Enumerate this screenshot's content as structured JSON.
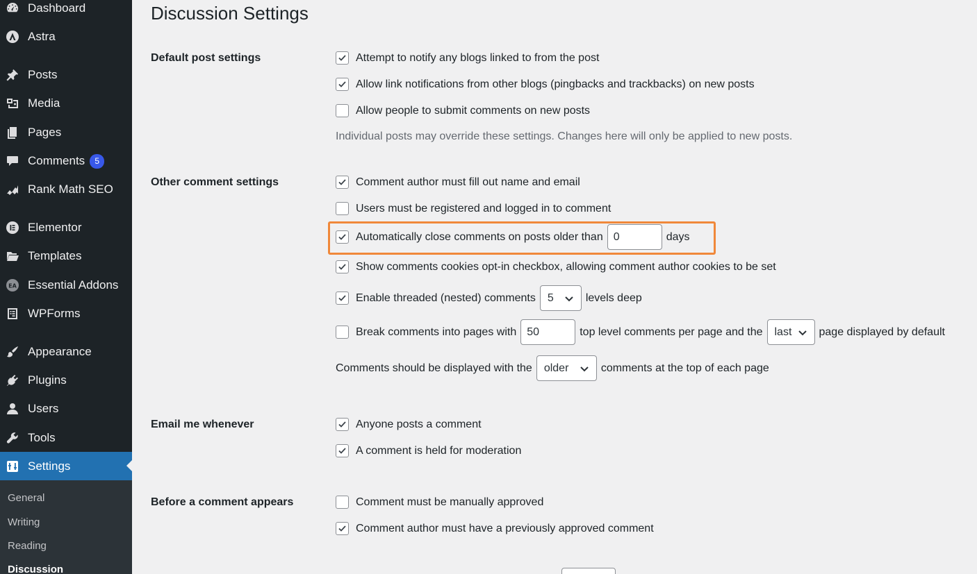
{
  "sidebar": {
    "items": [
      {
        "label": "Dashboard",
        "icon": "dashboard-icon"
      },
      {
        "label": "Astra",
        "icon": "astra-icon"
      },
      {
        "label": "Posts",
        "icon": "pin-icon"
      },
      {
        "label": "Media",
        "icon": "media-icon"
      },
      {
        "label": "Pages",
        "icon": "pages-icon"
      },
      {
        "label": "Comments",
        "icon": "comment-icon",
        "badge": "5"
      },
      {
        "label": "Rank Math SEO",
        "icon": "rank-math-icon"
      },
      {
        "label": "Elementor",
        "icon": "elementor-icon"
      },
      {
        "label": "Templates",
        "icon": "folder-icon"
      },
      {
        "label": "Essential Addons",
        "icon": "essential-addons-icon"
      },
      {
        "label": "WPForms",
        "icon": "wpforms-icon"
      },
      {
        "label": "Appearance",
        "icon": "brush-icon"
      },
      {
        "label": "Plugins",
        "icon": "plugin-icon"
      },
      {
        "label": "Users",
        "icon": "user-icon"
      },
      {
        "label": "Tools",
        "icon": "wrench-icon"
      },
      {
        "label": "Settings",
        "icon": "settings-icon"
      }
    ],
    "submenu": [
      "General",
      "Writing",
      "Reading",
      "Discussion"
    ]
  },
  "page": {
    "title": "Discussion Settings"
  },
  "sections": {
    "default_post": {
      "label": "Default post settings",
      "opt1": "Attempt to notify any blogs linked to from the post",
      "opt2": "Allow link notifications from other blogs (pingbacks and trackbacks) on new posts",
      "opt3": "Allow people to submit comments on new posts",
      "note": "Individual posts may override these settings. Changes here will only be applied to new posts."
    },
    "other_comment": {
      "label": "Other comment settings",
      "opt1": "Comment author must fill out name and email",
      "opt2": "Users must be registered and logged in to comment",
      "opt3_before": "Automatically close comments on posts older than",
      "opt3_value": "0",
      "opt3_after": "days",
      "opt4": "Show comments cookies opt-in checkbox, allowing comment author cookies to be set",
      "opt5_before": "Enable threaded (nested) comments",
      "opt5_value": "5",
      "opt5_after": "levels deep",
      "opt6_before": "Break comments into pages with",
      "opt6_value": "50",
      "opt6_middle": "top level comments per page and the",
      "opt6_select": "last",
      "opt6_after": "page displayed by default",
      "opt7_before": "Comments should be displayed with the",
      "opt7_select": "older",
      "opt7_after": "comments at the top of each page"
    },
    "email": {
      "label": "Email me whenever",
      "opt1": "Anyone posts a comment",
      "opt2": "A comment is held for moderation"
    },
    "before_appears": {
      "label": "Before a comment appears",
      "opt1": "Comment must be manually approved",
      "opt2": "Comment author must have a previously approved comment"
    }
  },
  "checkboxes": {
    "notify_blogs": true,
    "allow_pingbacks": true,
    "allow_comments": false,
    "require_name_email": true,
    "registration_required": false,
    "close_comments": true,
    "cookies_opt_in": true,
    "threaded_comments": true,
    "page_comments": false,
    "email_anyone_posts": true,
    "email_moderation": true,
    "manual_approval": false,
    "previously_approved": true
  },
  "colors": {
    "sidebar_bg": "#1d2327",
    "active": "#2271b1",
    "badge": "#3858e9",
    "highlight": "#f0883a"
  }
}
